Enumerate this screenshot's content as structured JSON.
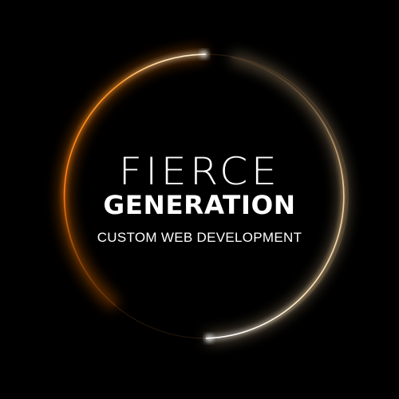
{
  "logo": {
    "line1": "FIERCE",
    "line2": "GENERATION",
    "tagline": "CUSTOM WEB DEVELOPMENT"
  },
  "colors": {
    "background": "#000000",
    "text": "#ffffff",
    "ring_orange": "#ff8a1e",
    "ring_warm_white": "#fff1c8",
    "ring_dim": "#5a3a1e"
  }
}
